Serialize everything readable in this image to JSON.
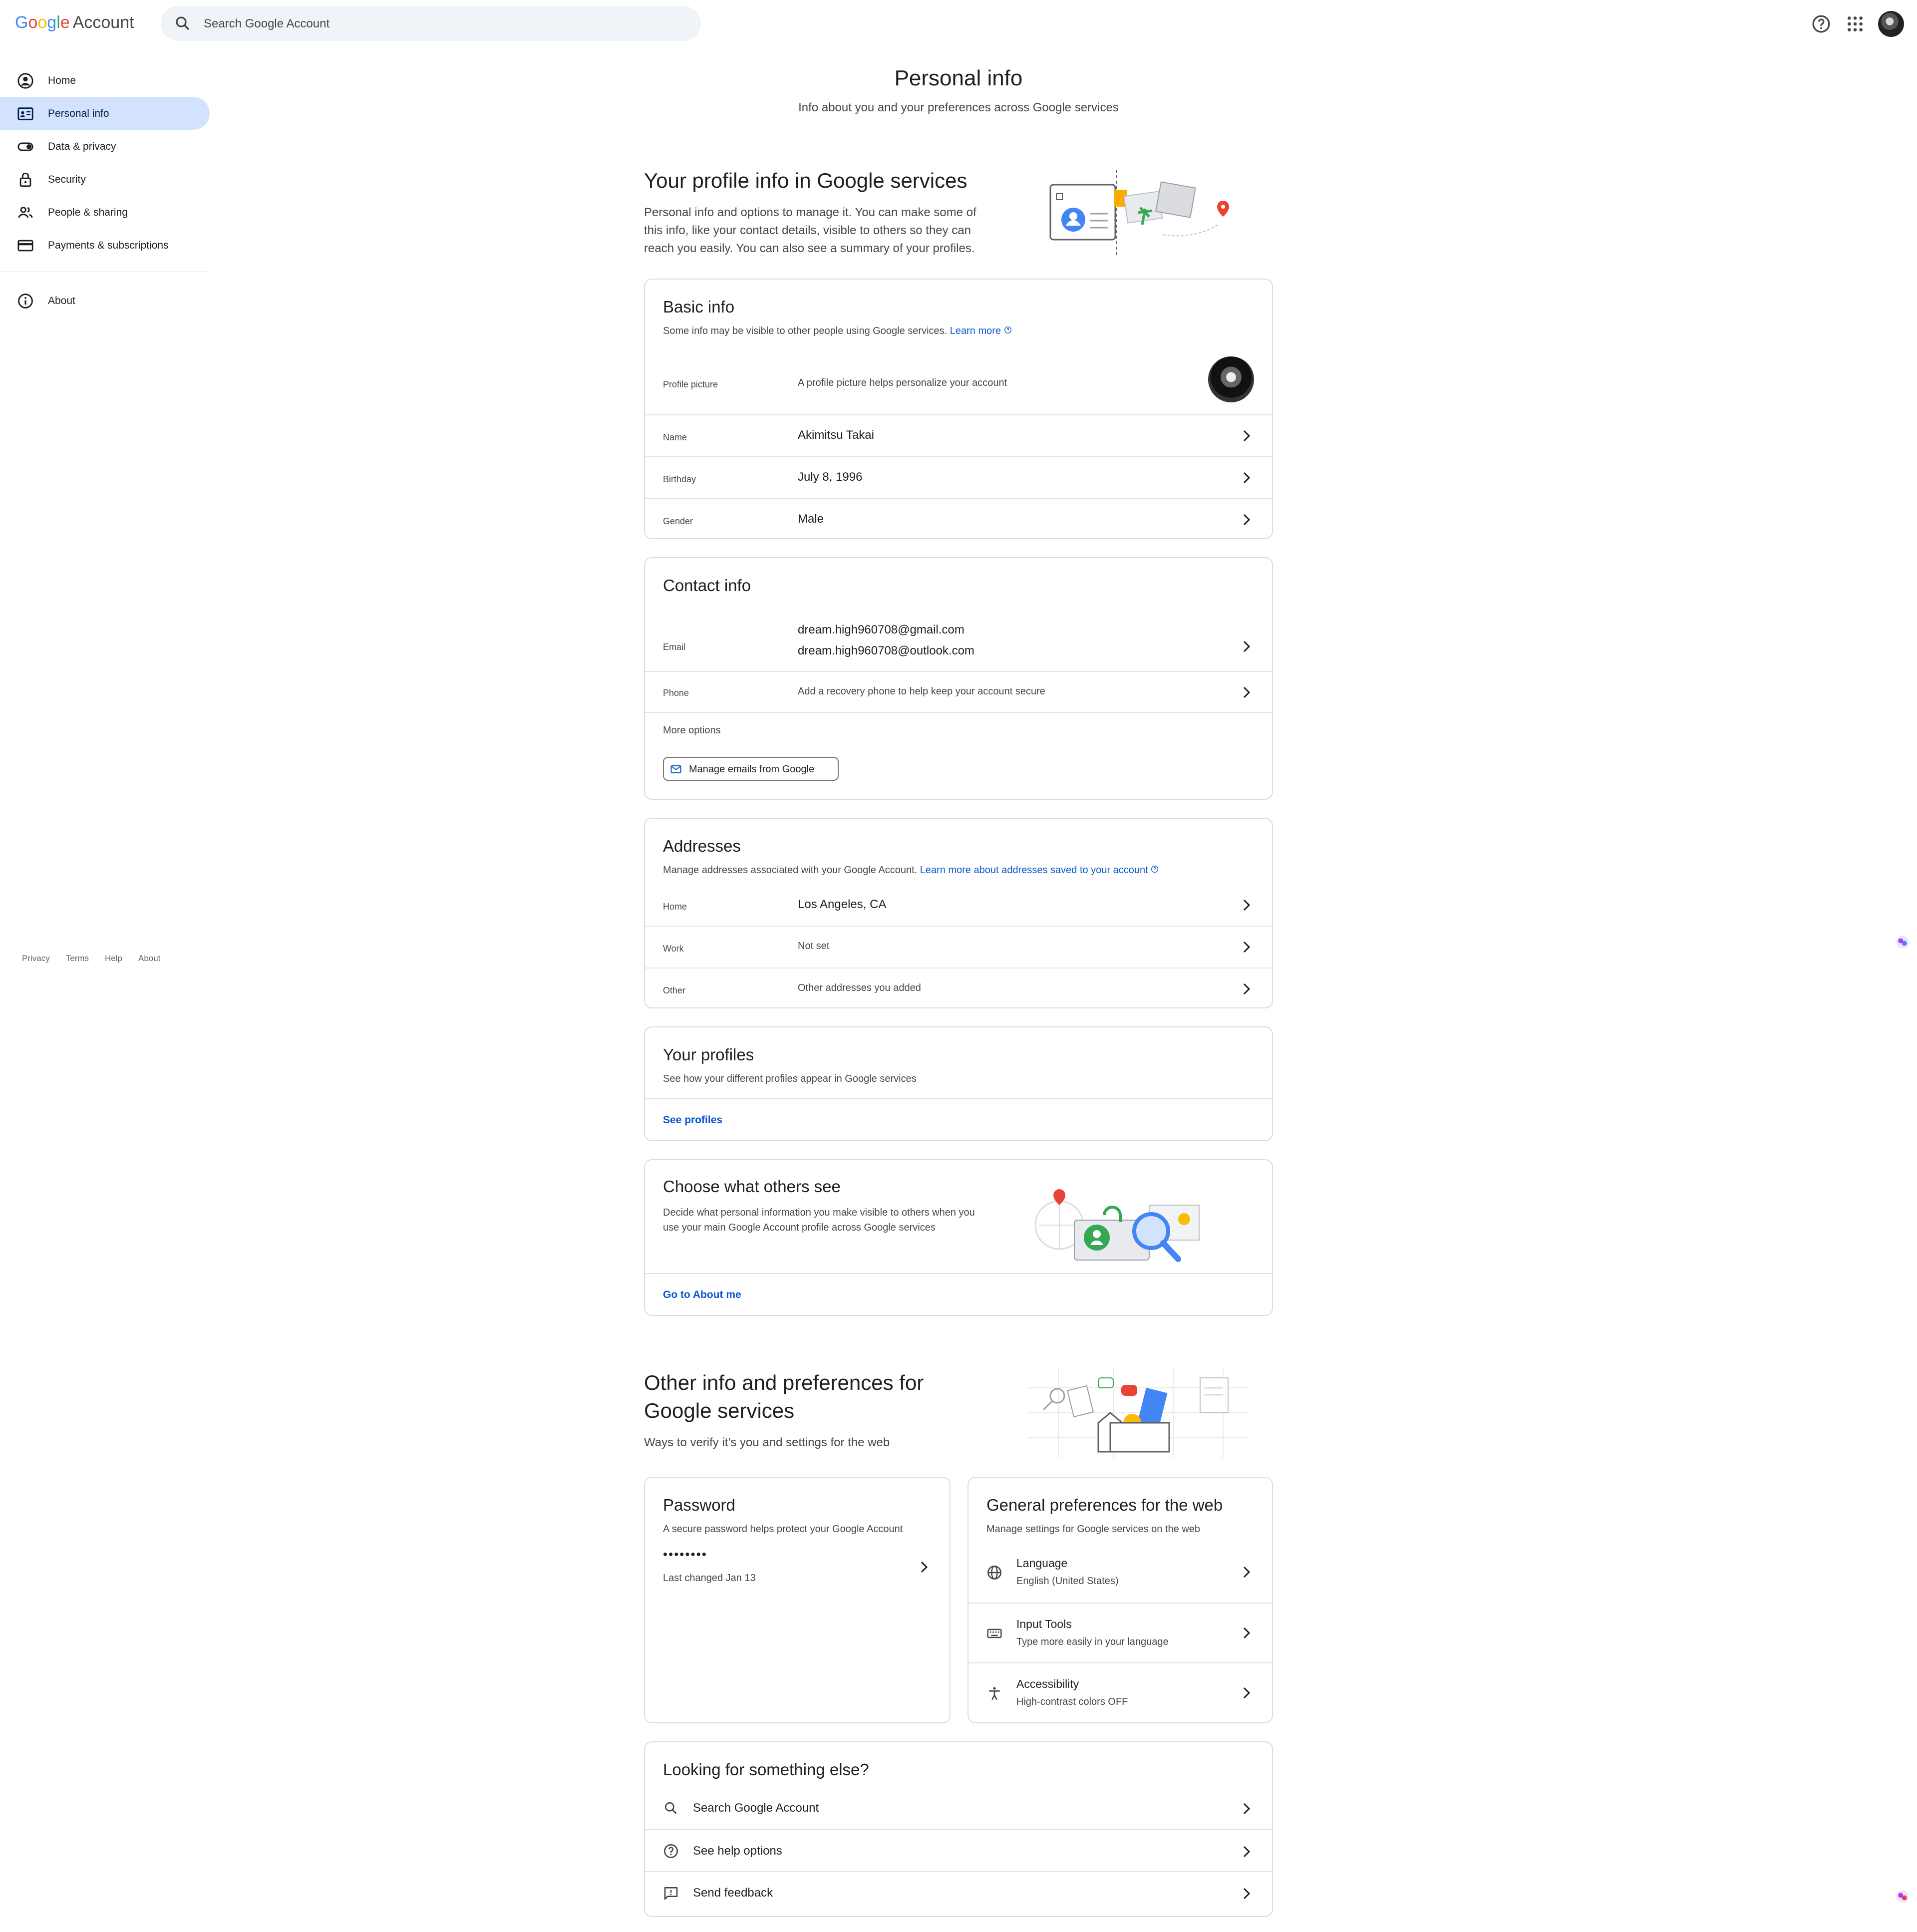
{
  "header": {
    "logo_google": "Google",
    "logo_account": "Account",
    "search_placeholder": "Search Google Account"
  },
  "sidebar": {
    "items": [
      {
        "label": "Home",
        "icon": "account-circle-icon"
      },
      {
        "label": "Personal info",
        "icon": "id-card-icon",
        "active": true
      },
      {
        "label": "Data & privacy",
        "icon": "toggle-icon"
      },
      {
        "label": "Security",
        "icon": "lock-icon"
      },
      {
        "label": "People & sharing",
        "icon": "people-icon"
      },
      {
        "label": "Payments & subscriptions",
        "icon": "credit-card-icon"
      },
      {
        "label": "About",
        "icon": "info-icon"
      }
    ],
    "footer": [
      "Privacy",
      "Terms",
      "Help",
      "About"
    ]
  },
  "page": {
    "title": "Personal info",
    "subtitle": "Info about you and your preferences across Google services"
  },
  "profile_section": {
    "title": "Your profile info in Google services",
    "desc_lines": [
      "Personal info and options to manage it. You can make some of",
      "this info, like your contact details, visible to others so they can",
      "reach you easily. You can also see a summary of your profiles."
    ]
  },
  "basic_info": {
    "title": "Basic info",
    "desc": "Some info may be visible to other people using Google services.",
    "learn_more": "Learn more",
    "profile_picture_label": "Profile picture",
    "profile_picture_desc": "A profile picture helps personalize your account",
    "rows": [
      {
        "label": "Name",
        "value": "Akimitsu Takai"
      },
      {
        "label": "Birthday",
        "value": "July 8, 1996"
      },
      {
        "label": "Gender",
        "value": "Male"
      }
    ]
  },
  "contact_info": {
    "title": "Contact info",
    "email_label": "Email",
    "emails": [
      "dream.high960708@gmail.com",
      "dream.high960708@outlook.com"
    ],
    "phone_label": "Phone",
    "phone_value": "Add a recovery phone to help keep your account secure",
    "more_options": "More options",
    "manage_emails_button": "Manage emails from Google"
  },
  "addresses": {
    "title": "Addresses",
    "desc": "Manage addresses associated with your Google Account.",
    "learn_more": "Learn more about addresses saved to your account",
    "rows": [
      {
        "label": "Home",
        "value": "Los Angeles, CA"
      },
      {
        "label": "Work",
        "value": "Not set"
      },
      {
        "label": "Other",
        "value": "Other addresses you added"
      }
    ]
  },
  "your_profiles": {
    "title": "Your profiles",
    "desc": "See how your different profiles appear in Google services",
    "link": "See profiles"
  },
  "choose_others": {
    "title": "Choose what others see",
    "desc_lines": [
      "Decide what personal information you make visible to others when you",
      "use your main Google Account profile across Google services"
    ],
    "link": "Go to About me"
  },
  "other_info": {
    "title_lines": [
      "Other info and preferences for",
      "Google services"
    ],
    "desc": "Ways to verify it’s you and settings for the web"
  },
  "password": {
    "title": "Password",
    "desc": "A secure password helps protect your Google Account",
    "dots": "••••••••",
    "last_changed": "Last changed Jan 13"
  },
  "general_prefs": {
    "title": "General preferences for the web",
    "desc": "Manage settings for Google services on the web",
    "rows": [
      {
        "title": "Language",
        "sub": "English (United States)",
        "icon": "globe-icon"
      },
      {
        "title": "Input Tools",
        "sub": "Type more easily in your language",
        "icon": "keyboard-icon"
      },
      {
        "title": "Accessibility",
        "sub": "High-contrast colors OFF",
        "icon": "accessibility-icon"
      }
    ]
  },
  "looking": {
    "title": "Looking for something else?",
    "rows": [
      {
        "label": "Search Google Account",
        "icon": "search-icon"
      },
      {
        "label": "See help options",
        "icon": "help-icon"
      },
      {
        "label": "Send feedback",
        "icon": "feedback-icon"
      }
    ]
  },
  "colors": {
    "accent": "#0b57d0",
    "active_nav": "#d3e3fd",
    "border": "#dadce0"
  }
}
